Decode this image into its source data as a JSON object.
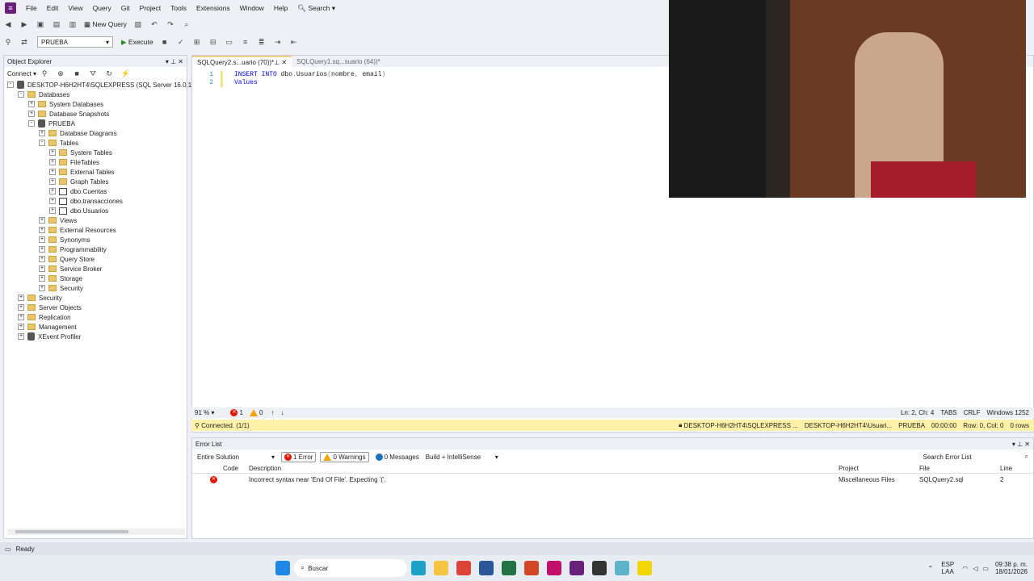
{
  "menu": {
    "items": [
      "File",
      "Edit",
      "View",
      "Query",
      "Git",
      "Project",
      "Tools",
      "Extensions",
      "Window",
      "Help"
    ],
    "search_label": "Search"
  },
  "toolbar": {
    "new_query_label": "New Query",
    "database": "PRUEBA",
    "execute_label": "Execute"
  },
  "object_explorer": {
    "title": "Object Explorer",
    "connect_label": "Connect",
    "nodes": [
      {
        "label": "DESKTOP-H6H2HT4\\SQLEXPRESS (SQL Server 16.0.1000 -",
        "depth": 0,
        "exp": "-",
        "icon": "server-icon"
      },
      {
        "label": "Databases",
        "depth": 1,
        "exp": "-",
        "icon": "folder-icon"
      },
      {
        "label": "System Databases",
        "depth": 2,
        "exp": "+",
        "icon": "folder-icon"
      },
      {
        "label": "Database Snapshots",
        "depth": 2,
        "exp": "+",
        "icon": "folder-icon"
      },
      {
        "label": "PRUEBA",
        "depth": 2,
        "exp": "-",
        "icon": "database-icon"
      },
      {
        "label": "Database Diagrams",
        "depth": 3,
        "exp": "+",
        "icon": "folder-icon"
      },
      {
        "label": "Tables",
        "depth": 3,
        "exp": "-",
        "icon": "folder-icon"
      },
      {
        "label": "System Tables",
        "depth": 4,
        "exp": "+",
        "icon": "folder-icon"
      },
      {
        "label": "FileTables",
        "depth": 4,
        "exp": "+",
        "icon": "folder-icon"
      },
      {
        "label": "External Tables",
        "depth": 4,
        "exp": "+",
        "icon": "folder-icon"
      },
      {
        "label": "Graph Tables",
        "depth": 4,
        "exp": "+",
        "icon": "folder-icon"
      },
      {
        "label": "dbo.Cuentas",
        "depth": 4,
        "exp": "+",
        "icon": "table-icon"
      },
      {
        "label": "dbo.transacciones",
        "depth": 4,
        "exp": "+",
        "icon": "table-icon"
      },
      {
        "label": "dbo.Usuarios",
        "depth": 4,
        "exp": "+",
        "icon": "table-icon"
      },
      {
        "label": "Views",
        "depth": 3,
        "exp": "+",
        "icon": "folder-icon"
      },
      {
        "label": "External Resources",
        "depth": 3,
        "exp": "+",
        "icon": "folder-icon"
      },
      {
        "label": "Synonyms",
        "depth": 3,
        "exp": "+",
        "icon": "folder-icon"
      },
      {
        "label": "Programmability",
        "depth": 3,
        "exp": "+",
        "icon": "folder-icon"
      },
      {
        "label": "Query Store",
        "depth": 3,
        "exp": "+",
        "icon": "folder-icon"
      },
      {
        "label": "Service Broker",
        "depth": 3,
        "exp": "+",
        "icon": "folder-icon"
      },
      {
        "label": "Storage",
        "depth": 3,
        "exp": "+",
        "icon": "folder-icon"
      },
      {
        "label": "Security",
        "depth": 3,
        "exp": "+",
        "icon": "folder-icon"
      },
      {
        "label": "Security",
        "depth": 1,
        "exp": "+",
        "icon": "folder-icon"
      },
      {
        "label": "Server Objects",
        "depth": 1,
        "exp": "+",
        "icon": "folder-icon"
      },
      {
        "label": "Replication",
        "depth": 1,
        "exp": "+",
        "icon": "folder-icon"
      },
      {
        "label": "Management",
        "depth": 1,
        "exp": "+",
        "icon": "folder-icon"
      },
      {
        "label": "XEvent Profiler",
        "depth": 1,
        "exp": "+",
        "icon": "profiler-icon"
      }
    ]
  },
  "editor": {
    "tabs": [
      {
        "label": "SQLQuery2.s...uario (70))*",
        "active": true
      },
      {
        "label": "SQLQuery1.sq...suario (64))*",
        "active": false
      }
    ],
    "lines": [
      {
        "num": "1",
        "tokens": [
          {
            "t": "INSERT INTO ",
            "c": "kw"
          },
          {
            "t": "dbo",
            "c": "id"
          },
          {
            "t": ".",
            "c": "gr"
          },
          {
            "t": "Usuarios",
            "c": "id"
          },
          {
            "t": "(",
            "c": "gr"
          },
          {
            "t": "nombre",
            "c": "id"
          },
          {
            "t": ", ",
            "c": "gr"
          },
          {
            "t": "email",
            "c": "id"
          },
          {
            "t": ")",
            "c": "gr"
          }
        ]
      },
      {
        "num": "2",
        "tokens": [
          {
            "t": "Values",
            "c": "kw"
          }
        ]
      }
    ],
    "zoom": "91 %",
    "error_count": "1",
    "warning_count": "0",
    "cursor_pos": "Ln: 2, Ch: 4",
    "tabs_mode": "TABS",
    "line_ending": "CRLF",
    "encoding": "Windows 1252"
  },
  "connection_bar": {
    "status": "Connected. (1/1)",
    "server": "DESKTOP-H6H2HT4\\SQLEXPRESS ...",
    "user": "DESKTOP-H6H2HT4\\Usuari...",
    "database": "PRUEBA",
    "elapsed": "00:00:00",
    "position": "Row: 0, Col: 0",
    "rows": "0 rows"
  },
  "error_list": {
    "title": "Error List",
    "scope": "Entire Solution",
    "errors_btn": "1 Error",
    "warnings_btn": "0 Warnings",
    "messages_btn": "0 Messages",
    "build_filter": "Build + IntelliSense",
    "search_placeholder": "Search Error List",
    "columns": [
      "Code",
      "Description",
      "Project",
      "File",
      "Line"
    ],
    "rows": [
      {
        "code": "",
        "description": "Incorrect syntax near 'End Of File'. Expecting '('.",
        "project": "Miscellaneous Files",
        "file": "SQLQuery2.sql",
        "line": "2"
      }
    ]
  },
  "status_bar": {
    "text": "Ready"
  },
  "taskbar": {
    "search_label": "Buscar",
    "lang": "ESP",
    "lang2": "LAA",
    "time": "09:38 p. m.",
    "date": "18/01/2026"
  },
  "colors": {
    "accent": "#68217a",
    "connbar": "#fff2a8",
    "error": "#e51400",
    "warning": "#f0a30a"
  }
}
